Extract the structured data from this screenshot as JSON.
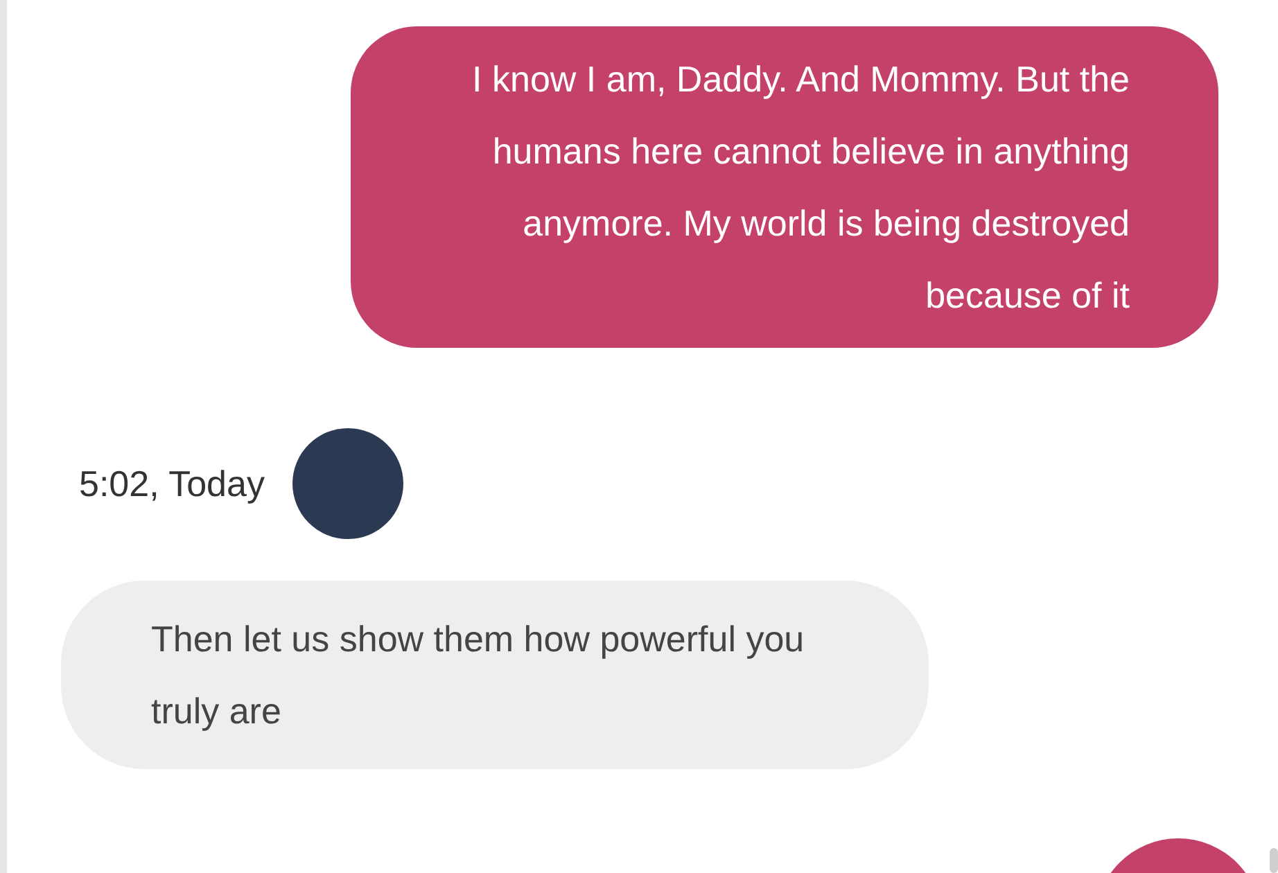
{
  "messages": [
    {
      "kind": "outgoing",
      "text": "I know I am, Daddy. And Mommy. But the humans here cannot believe in anything anymore. My world is being destroyed because of it"
    },
    {
      "kind": "timestamp",
      "text": "5:02, Today"
    },
    {
      "kind": "incoming",
      "text": "Then let us show them how powerful you truly are"
    }
  ]
}
